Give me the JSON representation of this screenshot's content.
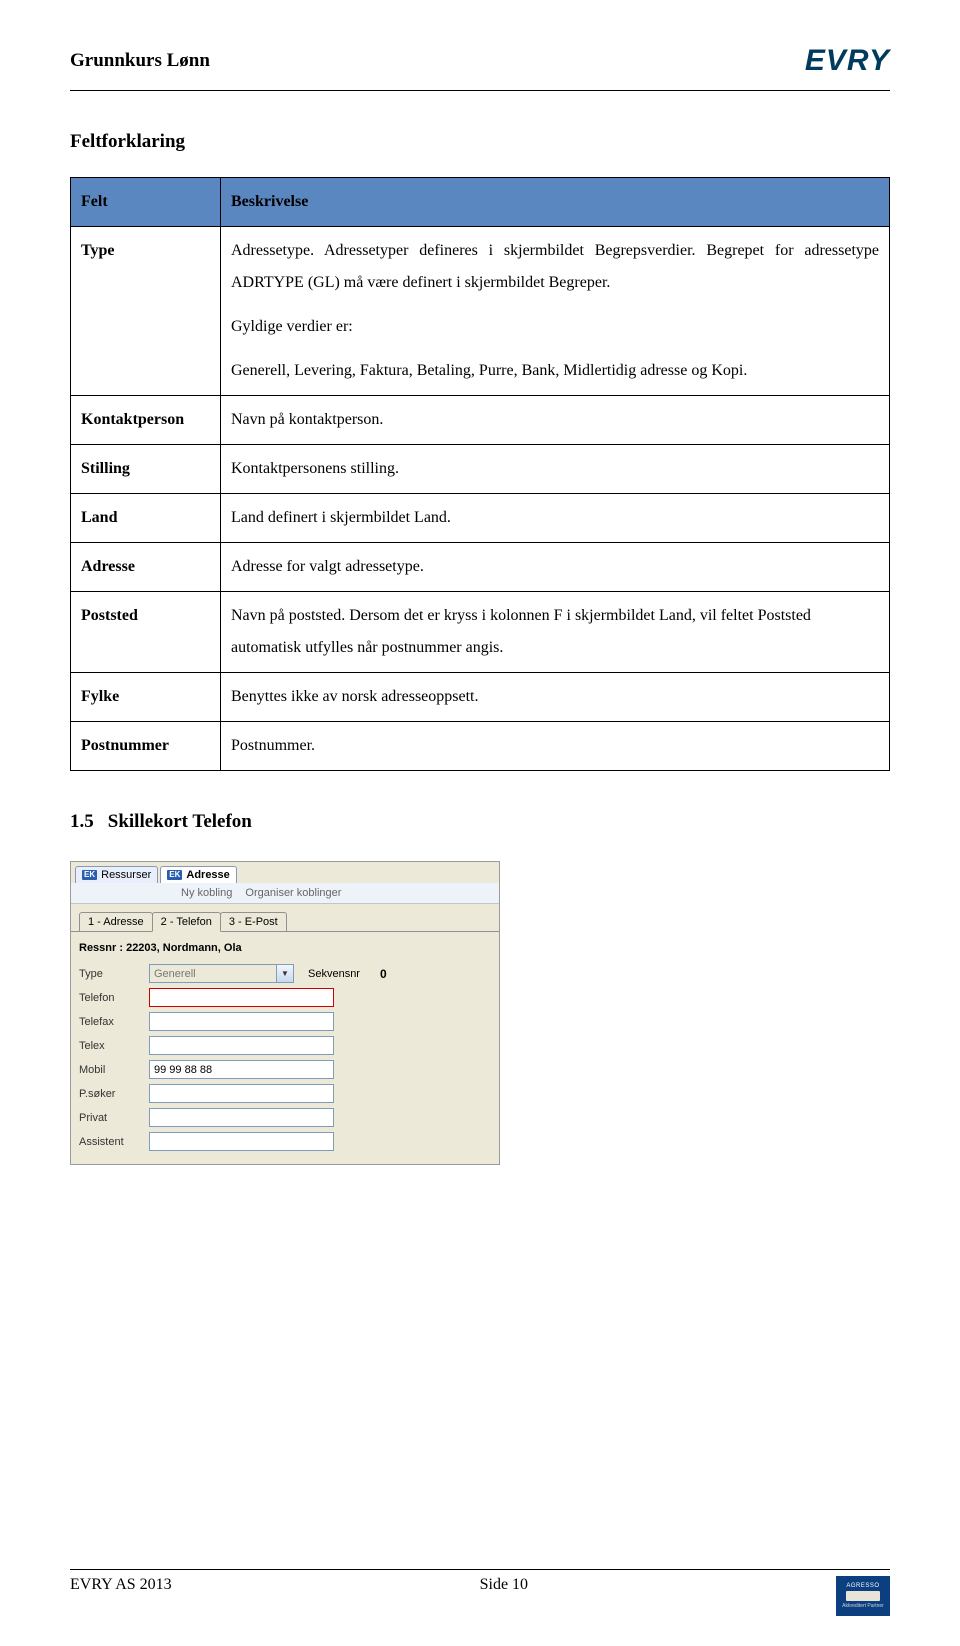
{
  "header": {
    "title": "Grunnkurs Lønn",
    "logo_text": "EVRY"
  },
  "section_title": "Feltforklaring",
  "table": {
    "col1": "Felt",
    "col2": "Beskrivelse",
    "rows": {
      "type": {
        "label": "Type",
        "p1": "Adressetype. Adressetyper defineres i skjermbildet Begrepsverdier. Begrepet for adressetype ADRTYPE (GL) må være definert i skjermbildet Begreper.",
        "p2": "Gyldige verdier er:",
        "p3": "Generell, Levering, Faktura, Betaling, Purre, Bank, Midlertidig adresse og Kopi."
      },
      "kontaktperson": {
        "label": "Kontaktperson",
        "desc": "Navn på kontaktperson."
      },
      "stilling": {
        "label": "Stilling",
        "desc": "Kontaktpersonens stilling."
      },
      "land": {
        "label": "Land",
        "desc": "Land definert i skjermbildet Land."
      },
      "adresse": {
        "label": "Adresse",
        "desc": "Adresse for valgt adressetype."
      },
      "poststed": {
        "label": "Poststed",
        "desc": "Navn på poststed. Dersom det er kryss i kolonnen F i skjermbildet Land, vil feltet Poststed automatisk utfylles når postnummer angis."
      },
      "fylke": {
        "label": "Fylke",
        "desc": "Benyttes ikke av norsk adresseoppsett."
      },
      "postnummer": {
        "label": "Postnummer",
        "desc": "Postnummer."
      }
    }
  },
  "subsection": {
    "num": "1.5",
    "title": "Skillekort Telefon"
  },
  "shot": {
    "ek": "EK",
    "top_tabs": {
      "t1": "Ressurser",
      "t2": "Adresse"
    },
    "toolbar": {
      "t1": "Ny kobling",
      "t2": "Organiser koblinger"
    },
    "subtabs": {
      "t1": "1 - Adresse",
      "t2": "2 - Telefon",
      "t3": "3 - E-Post"
    },
    "ressnr": "Ressnr : 22203, Nordmann, Ola",
    "labels": {
      "type": "Type",
      "type_val": "Generell",
      "sekv": "Sekvensnr",
      "sekv_val": "0",
      "telefon": "Telefon",
      "telefax": "Telefax",
      "telex": "Telex",
      "mobil": "Mobil",
      "mobil_val": "99 99 88 88",
      "psoker": "P.søker",
      "privat": "Privat",
      "assistent": "Assistent"
    }
  },
  "footer": {
    "left": "EVRY AS 2013",
    "right": "Side 10",
    "agresso_top": "AGRESSO",
    "agresso_bot": "Akkreditert Partner"
  }
}
